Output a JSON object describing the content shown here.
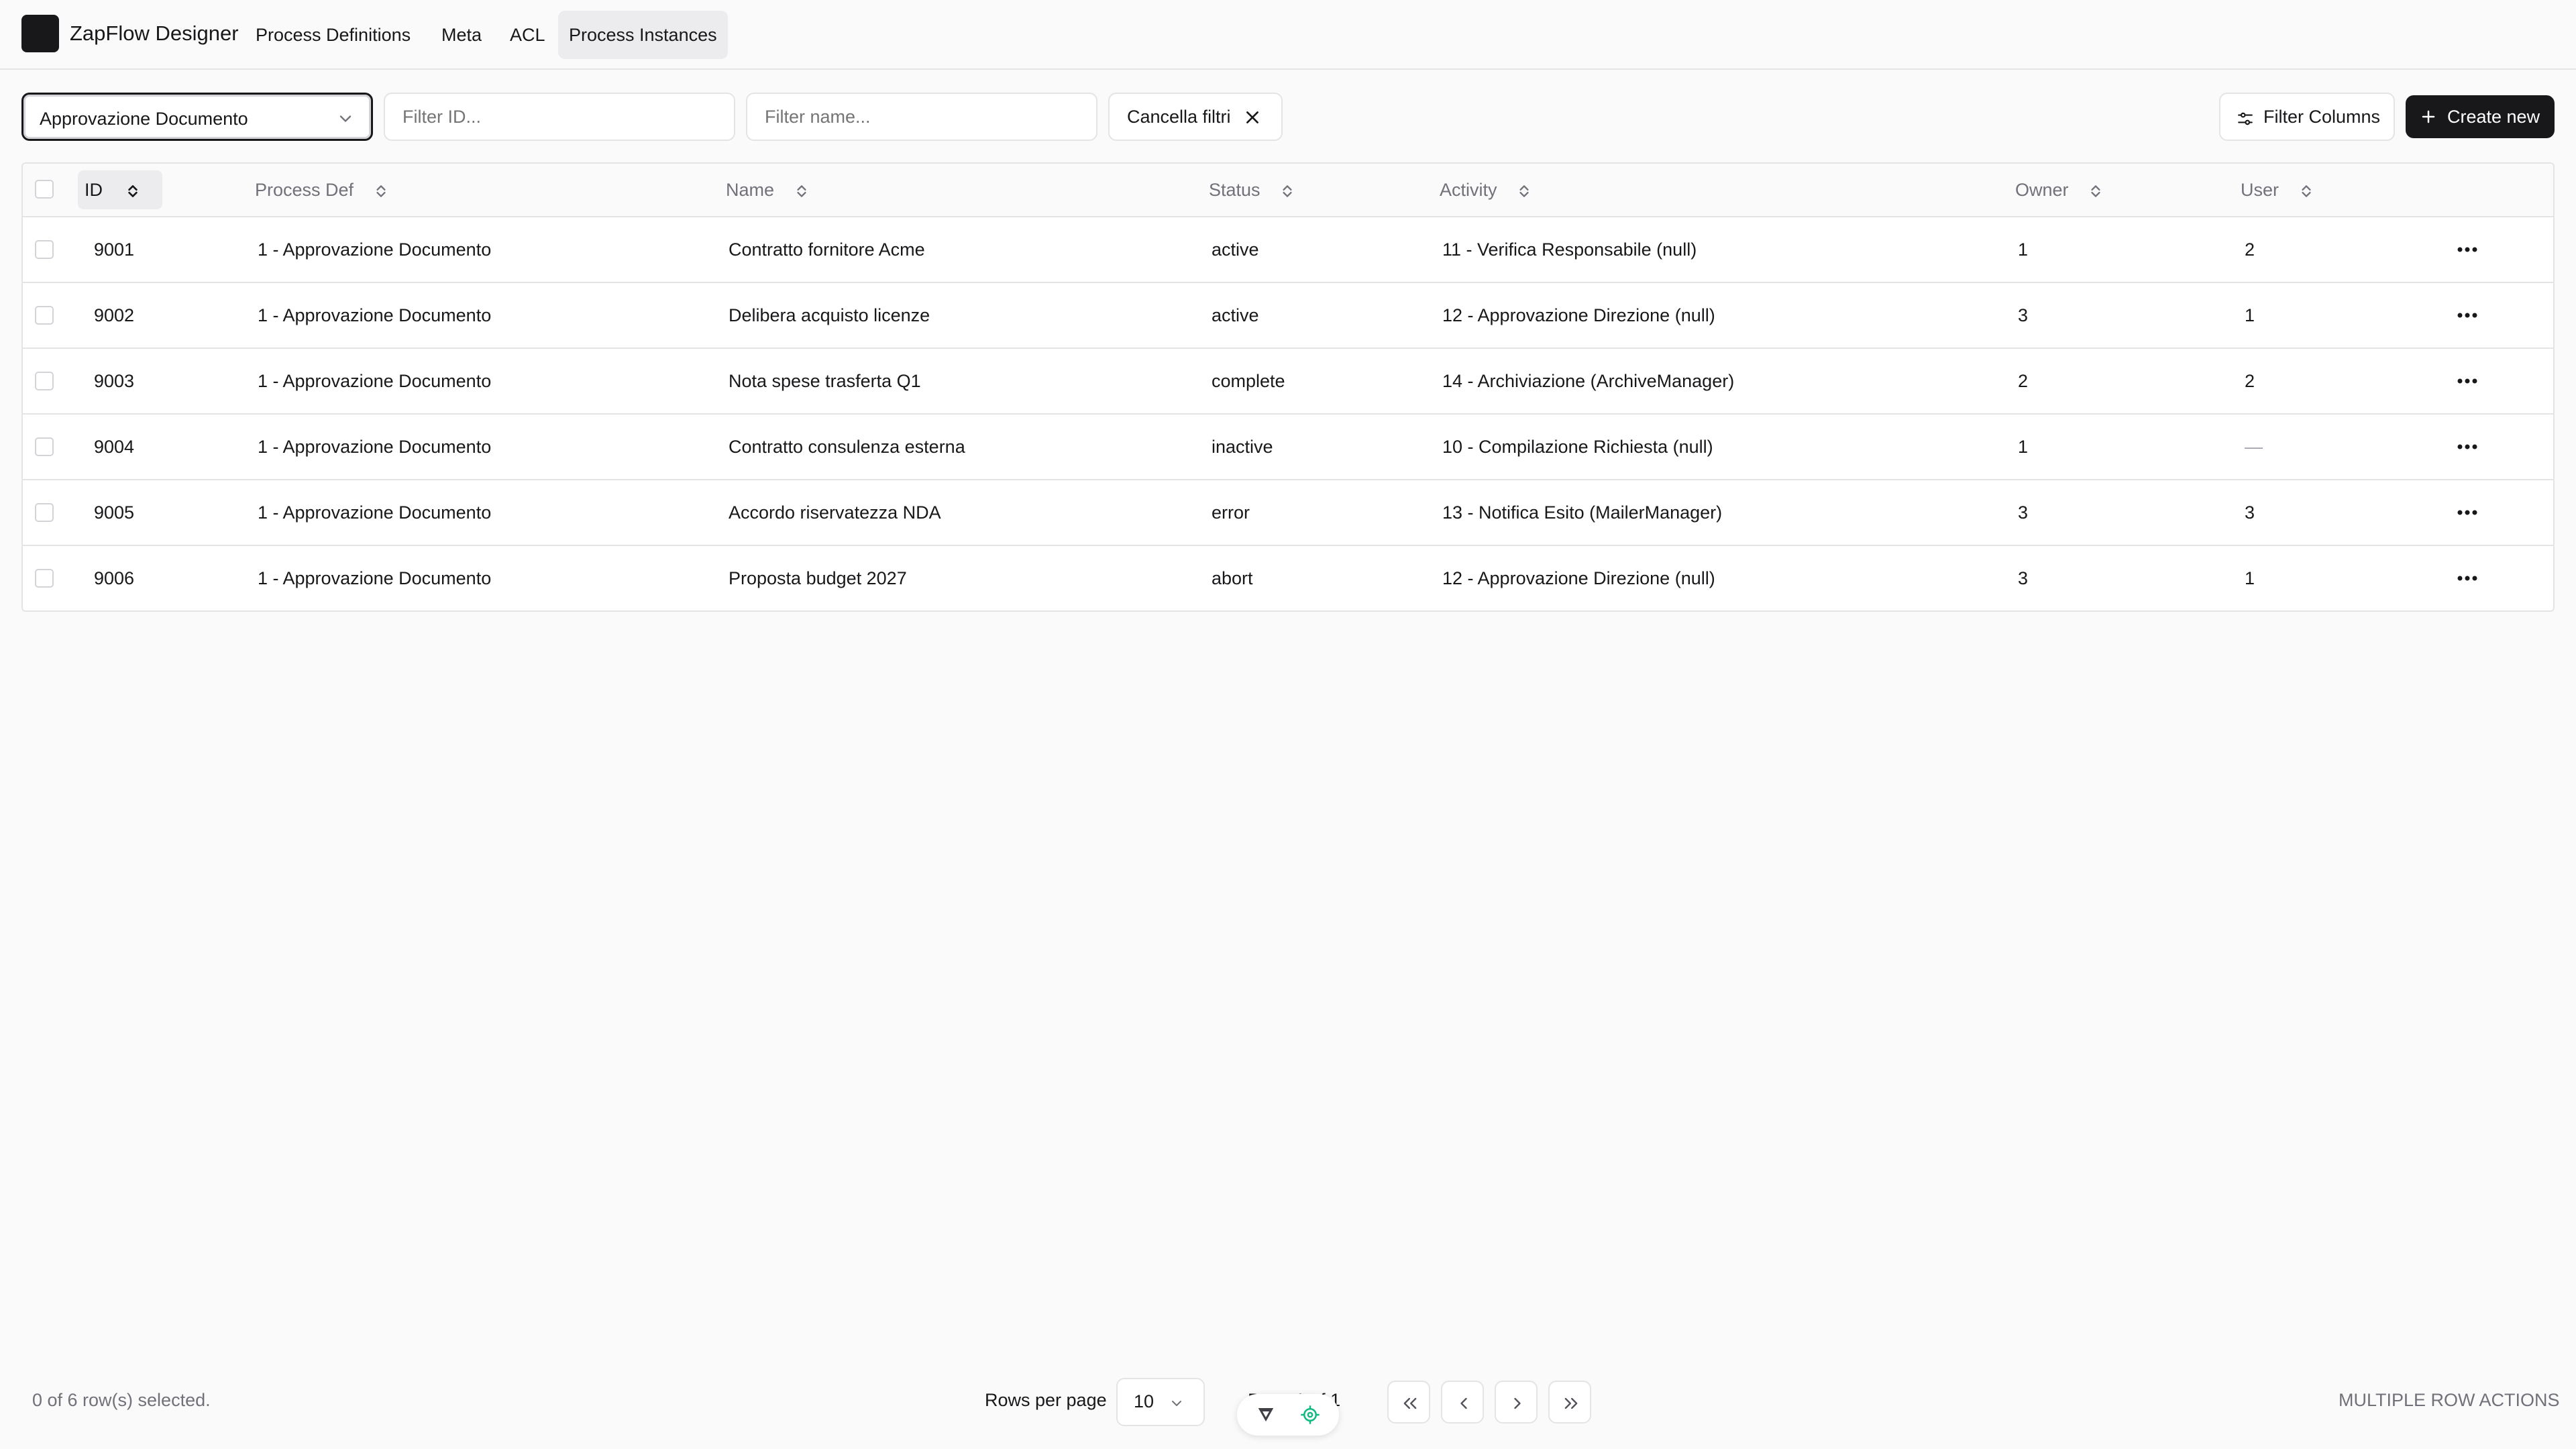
{
  "app": {
    "title": "ZapFlow Designer"
  },
  "nav": [
    {
      "label": "Process Definitions",
      "active": false
    },
    {
      "label": "Meta",
      "active": false
    },
    {
      "label": "ACL",
      "active": false
    },
    {
      "label": "Process Instances",
      "active": true
    }
  ],
  "filters": {
    "process_select_value": "Approvazione Documento",
    "id_placeholder": "Filter ID...",
    "name_placeholder": "Filter name...",
    "clear_label": "Cancella filtri",
    "filter_columns_label": "Filter Columns",
    "create_label": "Create new"
  },
  "table": {
    "columns": [
      "ID",
      "Process Def",
      "Name",
      "Status",
      "Activity",
      "Owner",
      "User"
    ],
    "rows": [
      {
        "id": "9001",
        "process_def": "1 - Approvazione Documento",
        "name": "Contratto fornitore Acme",
        "status": "active",
        "activity": "11 - Verifica Responsabile (null)",
        "owner": "1",
        "user": "2"
      },
      {
        "id": "9002",
        "process_def": "1 - Approvazione Documento",
        "name": "Delibera acquisto licenze",
        "status": "active",
        "activity": "12 - Approvazione Direzione (null)",
        "owner": "3",
        "user": "1"
      },
      {
        "id": "9003",
        "process_def": "1 - Approvazione Documento",
        "name": "Nota spese trasferta Q1",
        "status": "complete",
        "activity": "14 - Archiviazione (ArchiveManager)",
        "owner": "2",
        "user": "2"
      },
      {
        "id": "9004",
        "process_def": "1 - Approvazione Documento",
        "name": "Contratto consulenza esterna",
        "status": "inactive",
        "activity": "10 - Compilazione Richiesta (null)",
        "owner": "1",
        "user": "—"
      },
      {
        "id": "9005",
        "process_def": "1 - Approvazione Documento",
        "name": "Accordo riservatezza NDA",
        "status": "error",
        "activity": "13 - Notifica Esito (MailerManager)",
        "owner": "3",
        "user": "3"
      },
      {
        "id": "9006",
        "process_def": "1 - Approvazione Documento",
        "name": "Proposta budget 2027",
        "status": "abort",
        "activity": "12 - Approvazione Direzione (null)",
        "owner": "3",
        "user": "1"
      }
    ]
  },
  "footer": {
    "selection_text": "0 of 6 row(s) selected.",
    "rows_per_page_label": "Rows per page",
    "rows_per_page_value": "10",
    "page_text": "Page 1 of 1",
    "multi_actions_label": "MULTIPLE ROW ACTIONS"
  },
  "colors": {
    "primary": "#18181b",
    "border": "#e4e4e7",
    "muted": "#71717a",
    "overlay_green": "#10b981"
  }
}
